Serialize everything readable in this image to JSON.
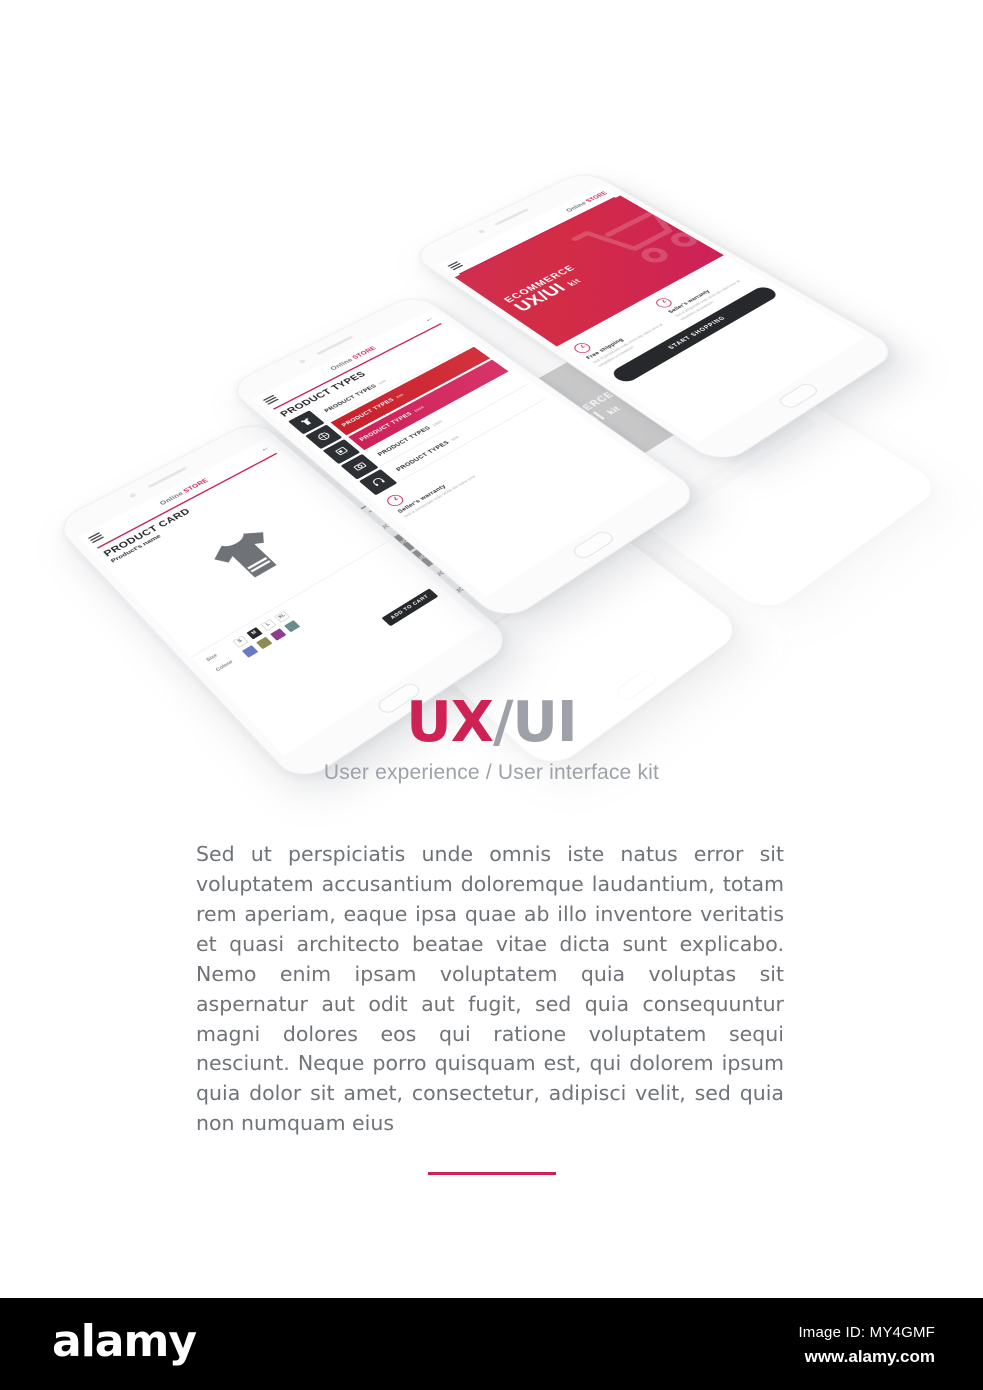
{
  "brand": {
    "accent": "#ce2255",
    "accent_dark": "#c8202c",
    "dark": "#26282b",
    "gray": "#9ea2a8"
  },
  "logo": {
    "primary": "UX",
    "secondary": "/UI"
  },
  "tagline": "User experience / User interface kit",
  "body_copy": "Sed ut perspiciatis unde omnis iste natus error sit voluptatem accusantium doloremque laudantium, totam rem aperiam, eaque ipsa quae ab illo inventore veritatis et quasi architecto beatae vitae dicta sunt explicabo. Nemo enim ipsam voluptatem quia voluptas sit aspernatur aut odit aut fugit, sed quia consequuntur magni dolores eos qui ratione voluptatem sequi nesciunt. Neque porro quisquam est, qui dolorem ipsum quia dolor sit amet, consectetur, adipisci velit, sed quia non numquam eius",
  "app": {
    "brand_light": "Online",
    "brand_bold": "STORE",
    "back_glyph": "←"
  },
  "screens": {
    "home": {
      "hero_line1": "ECOMMERCE",
      "hero_line2": "UX/UI",
      "hero_line2_small": "kit",
      "features": [
        {
          "title": "Free shipping",
          "desc": "Sed ut perspiciatis unde omnis iste natus error sit voluptatem accusantium"
        },
        {
          "title": "Seller's warranty",
          "desc": "Sed ut perspiciatis unde omnis iste natus error sit voluptatem accusantium"
        }
      ],
      "cta": "START SHOPPING"
    },
    "categories": {
      "title": "PRODUCT TYPES",
      "icons": [
        "tshirt-icon",
        "ball-icon",
        "appliance-icon",
        "camera-icon",
        "headphones-icon"
      ],
      "rows": [
        {
          "label": "PRODUCT TYPES",
          "count": "100",
          "state": "normal"
        },
        {
          "label": "PRODUCT TYPES",
          "count": "200",
          "state": "selected-red"
        },
        {
          "label": "PRODUCT TYPES",
          "count": "1000",
          "state": "selected-pink"
        },
        {
          "label": "PRODUCT TYPES",
          "count": "1500",
          "state": "normal"
        },
        {
          "label": "PRODUCT TYPES",
          "count": "300",
          "state": "normal"
        }
      ],
      "feature_title": "Seller's warranty",
      "feature_desc": "Sed ut perspiciatis unde omnis iste natus error"
    },
    "product": {
      "title": "PRODUCT CARD",
      "subtitle": "Product's name",
      "add_to_cart": "ADD TO CART",
      "size_label": "Size",
      "colour_label": "Colour",
      "sizes": [
        "S",
        "M",
        "L",
        "XL"
      ],
      "selected_size": "M",
      "colours": [
        "#6b79c4",
        "#8d8a52",
        "#8e3e8e",
        "#6b8c8c"
      ]
    }
  },
  "watermark": {
    "logo": "alamy",
    "image_id": "Image ID: MY4GMF",
    "url": "www.alamy.com"
  }
}
